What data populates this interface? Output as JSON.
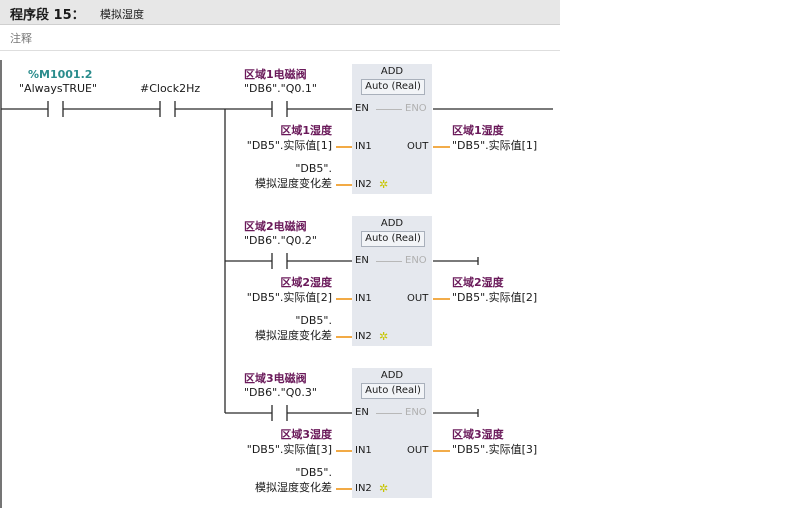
{
  "segment": {
    "title": "程序段 15：",
    "name": "模拟湿度",
    "comment": "注释"
  },
  "contacts": {
    "m1001": {
      "address": "%M1001.2",
      "symbol": "\"AlwaysTRUE\""
    },
    "clock": {
      "symbol": "#Clock2Hz"
    }
  },
  "rungs": [
    {
      "valve_label": "区域1电磁阀",
      "valve_address": "\"DB6\".\"Q0.1\"",
      "block": "ADD",
      "type": "Auto (Real)",
      "in1_label": "区域1湿度",
      "in1_value": "\"DB5\".实际值[1]",
      "in2_db": "\"DB5\".",
      "in2_value": "模拟湿度变化差",
      "out_label": "区域1湿度",
      "out_value": "\"DB5\".实际值[1]"
    },
    {
      "valve_label": "区域2电磁阀",
      "valve_address": "\"DB6\".\"Q0.2\"",
      "block": "ADD",
      "type": "Auto (Real)",
      "in1_label": "区域2湿度",
      "in1_value": "\"DB5\".实际值[2]",
      "in2_db": "\"DB5\".",
      "in2_value": "模拟湿度变化差",
      "out_label": "区域2湿度",
      "out_value": "\"DB5\".实际值[2]"
    },
    {
      "valve_label": "区域3电磁阀",
      "valve_address": "\"DB6\".\"Q0.3\"",
      "block": "ADD",
      "type": "Auto (Real)",
      "in1_label": "区域3湿度",
      "in1_value": "\"DB5\".实际值[3]",
      "in2_db": "\"DB5\".",
      "in2_value": "模拟湿度变化差",
      "out_label": "区域3湿度",
      "out_value": "\"DB5\".实际值[3]"
    }
  ],
  "pins": {
    "en": "EN",
    "eno": "ENO",
    "in1": "IN1",
    "in2": "IN2",
    "out": "OUT",
    "star": "✲"
  }
}
